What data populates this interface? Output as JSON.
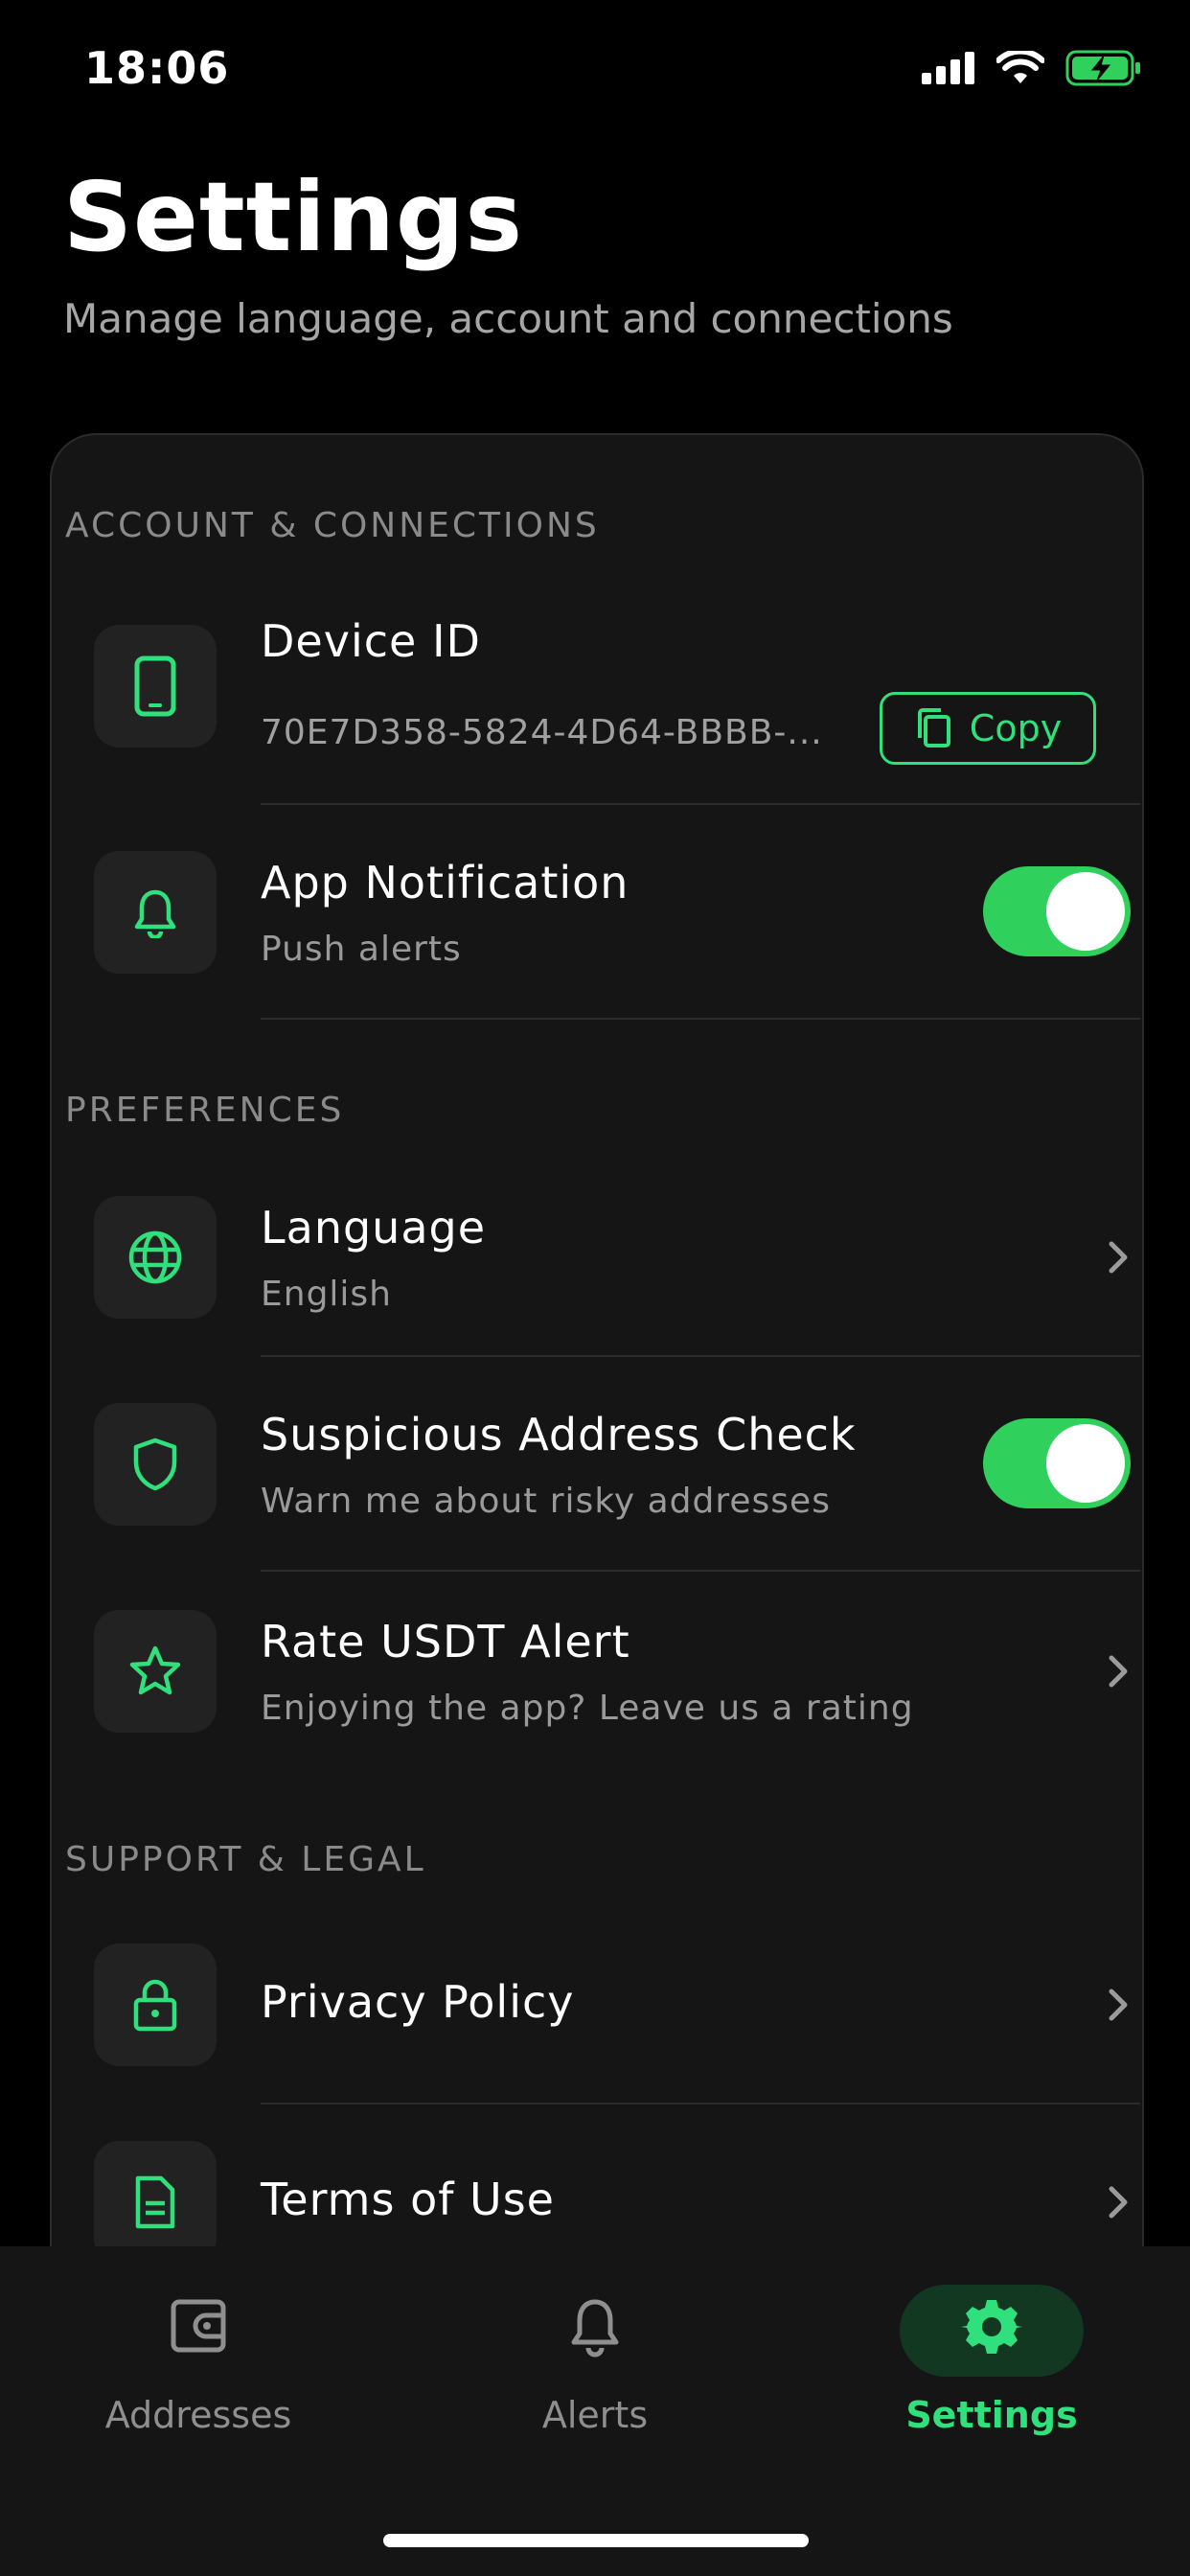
{
  "status_bar": {
    "time": "18:06"
  },
  "header": {
    "title": "Settings",
    "subtitle": "Manage language, account and connections"
  },
  "sections": {
    "account": "ACCOUNT & CONNECTIONS",
    "preferences": "PREFERENCES",
    "support": "SUPPORT & LEGAL"
  },
  "device_id": {
    "title": "Device ID",
    "value": "70E7D358-5824-4D64-BBBB-...",
    "copy_label": "Copy"
  },
  "notification": {
    "title": "App Notification",
    "subtitle": "Push alerts",
    "enabled": true
  },
  "language": {
    "title": "Language",
    "subtitle": "English"
  },
  "suspicious": {
    "title": "Suspicious Address Check",
    "subtitle": "Warn me about risky addresses",
    "enabled": true
  },
  "rate": {
    "title": "Rate USDT Alert",
    "subtitle": "Enjoying the app? Leave us a rating"
  },
  "privacy": {
    "title": "Privacy Policy"
  },
  "terms": {
    "title": "Terms of Use"
  },
  "tabbar": {
    "tabs": [
      {
        "label": "Addresses",
        "icon": "wallet-icon",
        "active": false
      },
      {
        "label": "Alerts",
        "icon": "bell-icon",
        "active": false
      },
      {
        "label": "Settings",
        "icon": "gear-icon",
        "active": true
      }
    ]
  },
  "colors": {
    "accent": "#2fe07c",
    "toggle_on": "#2fd05c",
    "background": "#000000",
    "card": "#151515"
  }
}
